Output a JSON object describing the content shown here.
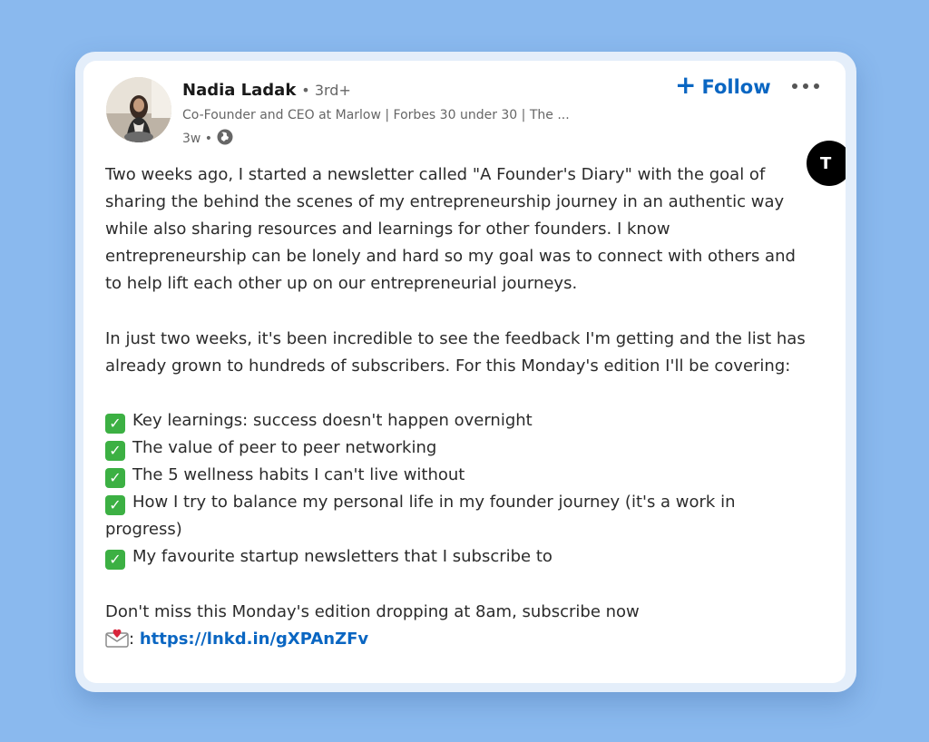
{
  "author": {
    "name": "Nadia Ladak",
    "degree": "• 3rd+",
    "headline": "Co-Founder and CEO at Marlow | Forbes 30 under 30 | The ...",
    "time": "3w •"
  },
  "follow_button": {
    "icon": "plus-icon",
    "label": "Follow"
  },
  "more_button": {
    "icon": "more-icon"
  },
  "floating_badge": {
    "label": "T"
  },
  "post": {
    "p1": "Two weeks ago, I started a newsletter called \"A Founder's Diary\" with the goal of sharing the behind the scenes of my entrepreneurship journey in an authentic way while also sharing resources and learnings for other founders. I know entrepreneurship can be lonely and hard so my goal was to connect with others and to help lift each other up on our entrepreneurial journeys.",
    "p2": "In just two weeks, it's been incredible to see the feedback I'm getting and the list has already grown to hundreds of subscribers. For this Monday's edition I'll be covering:",
    "checklist": [
      "Key learnings: success doesn't happen overnight",
      "The value of peer to peer networking",
      "The 5 wellness habits I can't live without",
      "How I try to balance my personal life in my founder journey (it's a work in progress)",
      "My favourite startup newsletters that I subscribe to"
    ],
    "cta": "Don't miss this Monday's edition dropping at 8am, subscribe now",
    "link_prefix": ":",
    "link": "https://lnkd.in/gXPAnZFv"
  },
  "colors": {
    "background": "#8ab9ee",
    "link": "#0a66c2",
    "check": "#3cb043"
  }
}
